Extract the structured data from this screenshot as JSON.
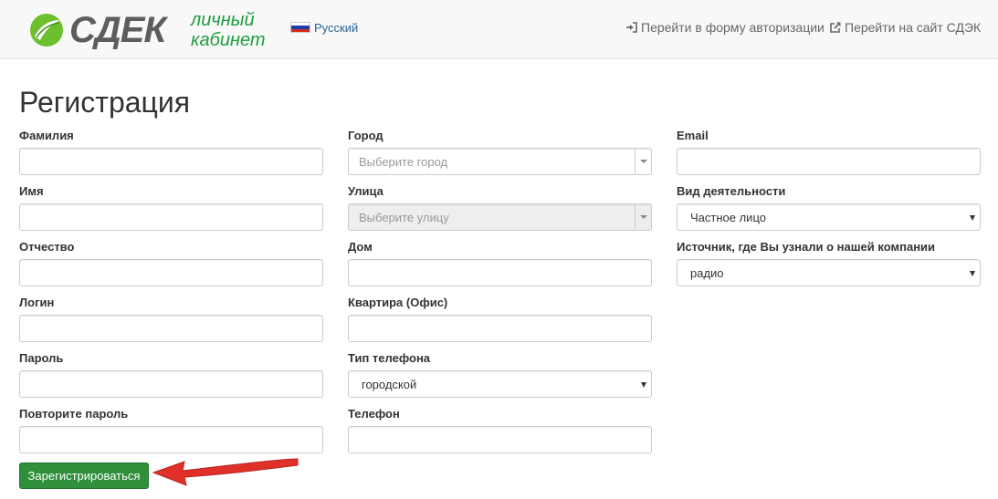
{
  "header": {
    "logo_text": "СДЕК",
    "logo_sub_line1": "личный",
    "logo_sub_line2": "кабинет",
    "language": "Русский",
    "links": [
      {
        "label": "Перейти в форму авторизации",
        "icon": "sign-in-icon"
      },
      {
        "label": "Перейти на сайт СДЭК",
        "icon": "external-link-icon"
      }
    ]
  },
  "page": {
    "title": "Регистрация"
  },
  "form": {
    "col1": [
      {
        "label": "Фамилия",
        "value": ""
      },
      {
        "label": "Имя",
        "value": ""
      },
      {
        "label": "Отчество",
        "value": ""
      },
      {
        "label": "Логин",
        "value": ""
      },
      {
        "label": "Пароль",
        "value": ""
      },
      {
        "label": "Повторите пароль",
        "value": ""
      }
    ],
    "col2": {
      "city": {
        "label": "Город",
        "placeholder": "Выберите город"
      },
      "street": {
        "label": "Улица",
        "placeholder": "Выберите улицу"
      },
      "house": {
        "label": "Дом",
        "value": ""
      },
      "apartment": {
        "label": "Квартира (Офис)",
        "value": ""
      },
      "phone_type": {
        "label": "Тип телефона",
        "selected": "городской"
      },
      "phone": {
        "label": "Телефон",
        "value": ""
      }
    },
    "col3": {
      "email": {
        "label": "Email",
        "value": ""
      },
      "activity": {
        "label": "Вид деятельности",
        "selected": "Частное лицо"
      },
      "source": {
        "label": "Источник, где Вы узнали о нашей компании",
        "selected": "радио"
      }
    },
    "submit_label": "Зарегистрироваться"
  },
  "colors": {
    "brand_green": "#1d9d3e",
    "button_green": "#2f8f3a",
    "arrow_red": "#e0302a"
  }
}
